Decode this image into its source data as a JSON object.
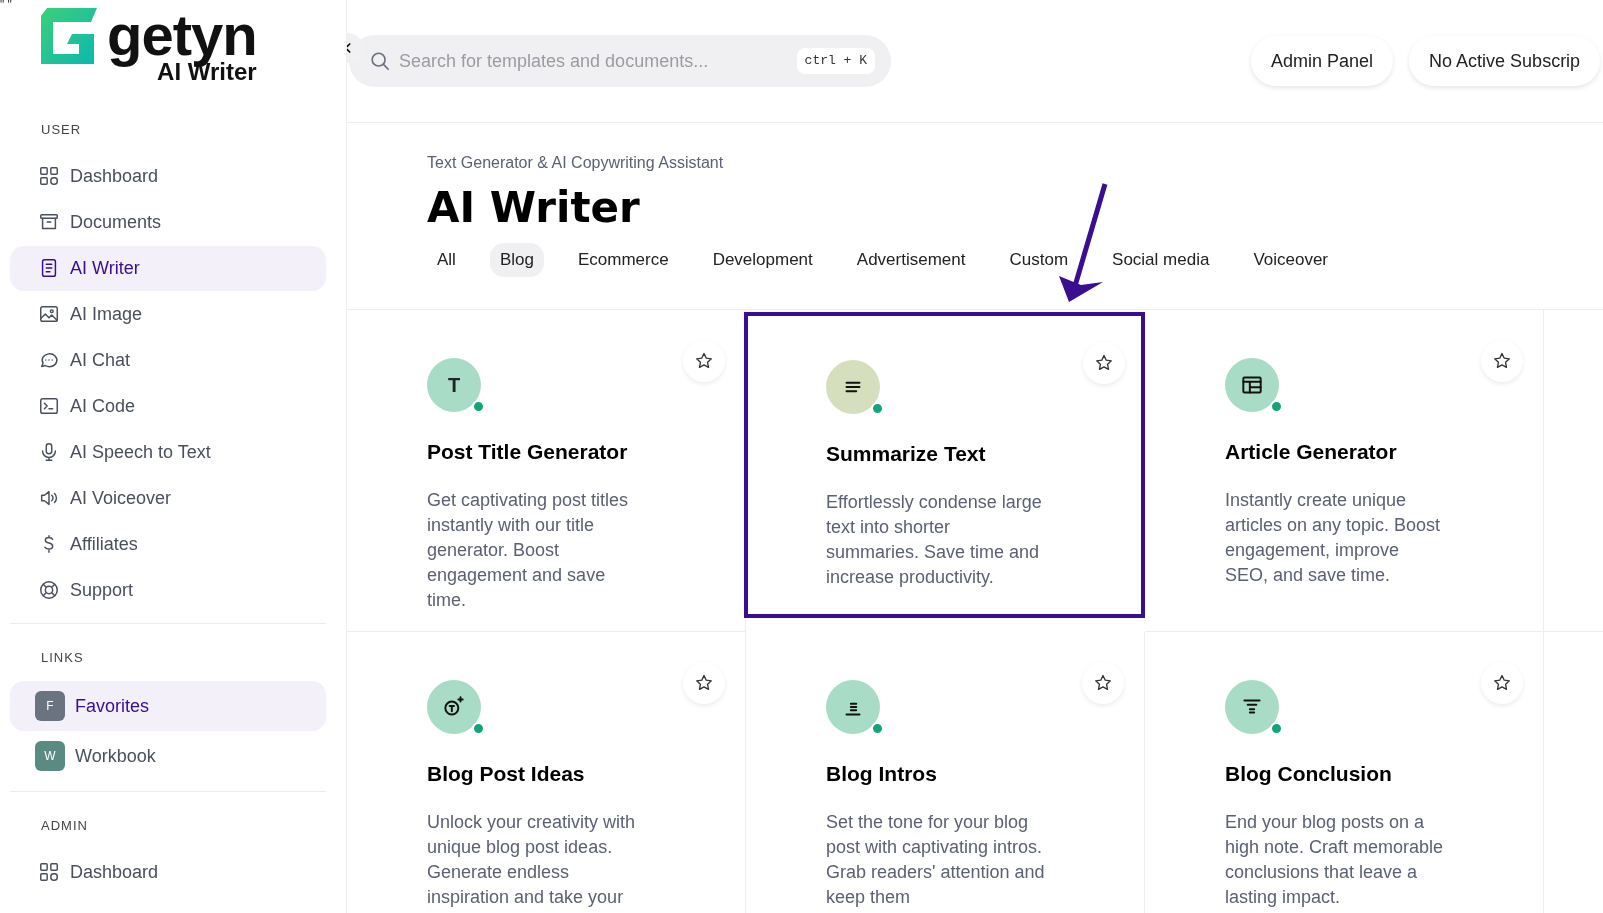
{
  "corner_mark": "\" \"",
  "logo": {
    "name": "getyn",
    "subtitle": "AI Writer"
  },
  "sidebar": {
    "sections": [
      {
        "heading": "USER",
        "items": [
          {
            "label": "Dashboard",
            "selected": false
          },
          {
            "label": "Documents",
            "selected": false
          },
          {
            "label": "AI Writer",
            "selected": true
          },
          {
            "label": "AI Image",
            "selected": false
          },
          {
            "label": "AI Chat",
            "selected": false
          },
          {
            "label": "AI Code",
            "selected": false
          },
          {
            "label": "AI Speech to Text",
            "selected": false
          },
          {
            "label": "AI Voiceover",
            "selected": false
          },
          {
            "label": "Affiliates",
            "selected": false
          },
          {
            "label": "Support",
            "selected": false
          }
        ]
      },
      {
        "heading": "LINKS",
        "items": [
          {
            "label": "Favorites",
            "letter": "F",
            "color": "#6b7280",
            "selected": true
          },
          {
            "label": "Workbook",
            "letter": "W",
            "color": "#5b8a82",
            "selected": false
          }
        ]
      },
      {
        "heading": "ADMIN",
        "items": [
          {
            "label": "Dashboard",
            "selected": false
          }
        ]
      }
    ]
  },
  "search": {
    "placeholder": "Search for templates and documents...",
    "shortcut": "ctrl + K"
  },
  "top_buttons": [
    "Admin Panel",
    "No Active Subscrip"
  ],
  "header": {
    "subtitle": "Text Generator & AI Copywriting Assistant",
    "title": "AI Writer"
  },
  "filters": [
    {
      "label": "All",
      "selected": false
    },
    {
      "label": "Blog",
      "selected": true
    },
    {
      "label": "Ecommerce",
      "selected": false
    },
    {
      "label": "Development",
      "selected": false
    },
    {
      "label": "Advertisement",
      "selected": false
    },
    {
      "label": "Custom",
      "selected": false
    },
    {
      "label": "Social media",
      "selected": false
    },
    {
      "label": "Voiceover",
      "selected": false
    }
  ],
  "cards": [
    {
      "title": "Post Title Generator",
      "description": "Get captivating post titles instantly with our title generator. Boost engagement and save time.",
      "icon_text": "T",
      "color": "#a8dcc6",
      "highlighted": false
    },
    {
      "title": "Summarize Text",
      "description": "Effortlessly condense large text into shorter summaries. Save time and increase productivity.",
      "color": "#d6dfbd",
      "highlighted": true
    },
    {
      "title": "Article Generator",
      "description": "Instantly create unique articles on any topic. Boost engagement, improve SEO, and save time.",
      "color": "#a8dcc6",
      "highlighted": false
    },
    {
      "title": "Blog Post Ideas",
      "description": "Unlock your creativity with unique blog post ideas. Generate endless inspiration and take your",
      "color": "#a8dcc6",
      "highlighted": false
    },
    {
      "title": "Blog Intros",
      "description": "Set the tone for your blog post with captivating intros. Grab readers' attention and keep them",
      "color": "#a8dcc6",
      "highlighted": false
    },
    {
      "title": "Blog Conclusion",
      "description": "End your blog posts on a high note. Craft memorable conclusions that leave a lasting impact.",
      "color": "#a8dcc6",
      "highlighted": false
    }
  ]
}
